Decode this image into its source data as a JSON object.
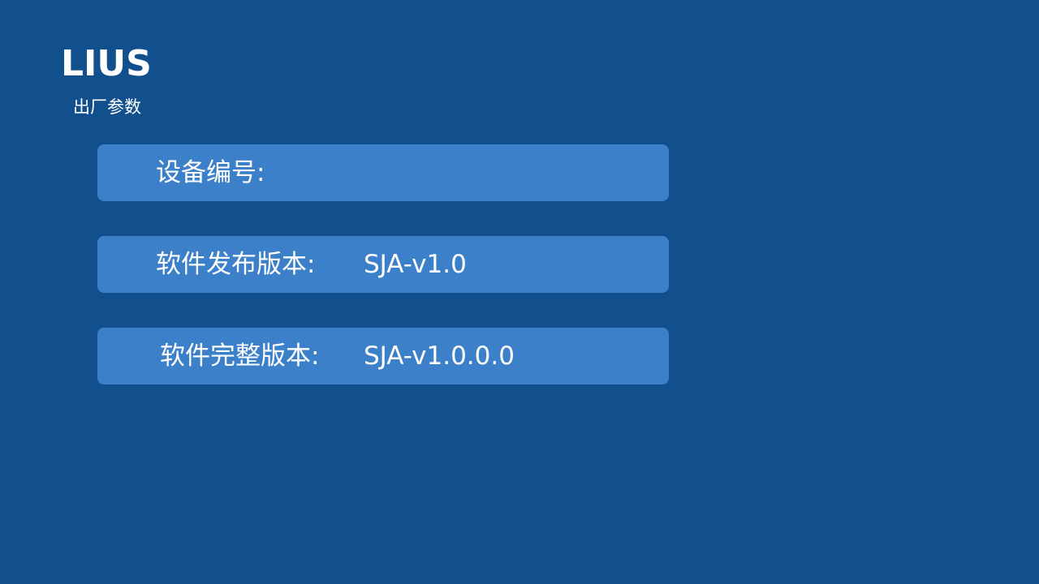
{
  "header": {
    "brand": "LIUS",
    "subtitle": "出厂参数"
  },
  "rows": [
    {
      "label": "设备编号:",
      "value": ""
    },
    {
      "label": "软件发布版本:",
      "value": "SJA-v1.0"
    },
    {
      "label": "软件完整版本:",
      "value": "SJA-v1.0.0.0"
    }
  ],
  "colors": {
    "background": "#124f8d",
    "panel": "#3b80c8",
    "text": "#ffffff"
  }
}
